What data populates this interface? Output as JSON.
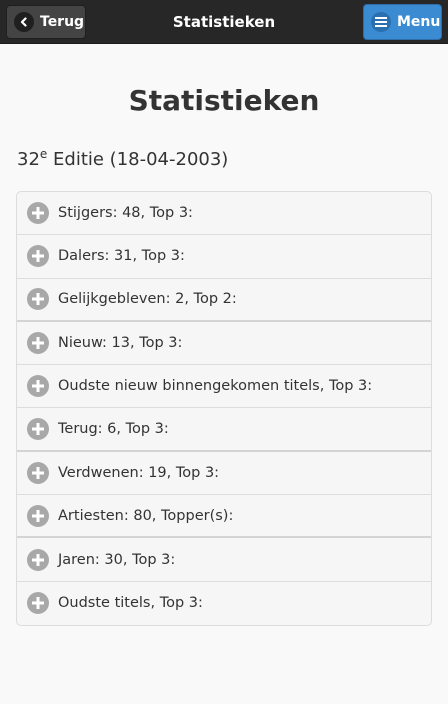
{
  "header": {
    "title": "Statistieken",
    "back_label": "Terug",
    "menu_label": "Menu"
  },
  "page": {
    "title": "Statistieken",
    "edition_number": "32",
    "edition_sup": "e",
    "edition_rest": " Editie (18-04-2003)"
  },
  "list": {
    "items": [
      {
        "label": "Stijgers: 48, Top 3:"
      },
      {
        "label": "Dalers: 31, Top 3:"
      },
      {
        "label": "Gelijkgebleven: 2, Top 2:"
      },
      {
        "label": "Nieuw: 13, Top 3:"
      },
      {
        "label": "Oudste nieuw binnengekomen titels, Top 3:"
      },
      {
        "label": "Terug: 6, Top 3:"
      },
      {
        "label": "Verdwenen: 19, Top 3:"
      },
      {
        "label": "Artiesten: 80, Topper(s):"
      },
      {
        "label": "Jaren: 30, Top 3:"
      },
      {
        "label": "Oudste titels, Top 3:"
      }
    ]
  },
  "icons": {
    "back": "chevron-left-icon",
    "menu": "hamburger-icon",
    "expand": "plus-circle-icon"
  }
}
